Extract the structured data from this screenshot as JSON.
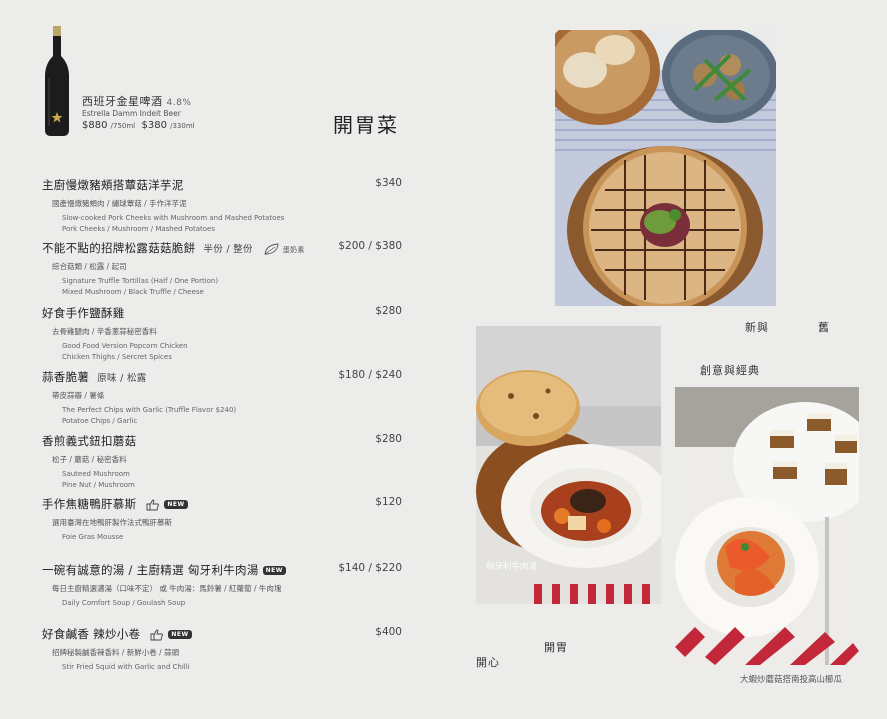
{
  "beer": {
    "name_zh": "西班牙金星啤酒",
    "abv": "4.8%",
    "name_en": "Estrella Damm Indeit Beer",
    "price_large": "$880",
    "vol_large": "/750ml",
    "price_small": "$380",
    "vol_small": "/330ml"
  },
  "section_title": "開胃菜",
  "items": [
    {
      "name": "主廚慢燉豬頰搭蕈菇洋芋泥",
      "price": "$340",
      "desc_zh": "國產慢燉豬頰肉 / 繡球蕈菇 / 手作洋芋泥",
      "desc_en": [
        "Slow-cooked Pork Cheeks with Mushroom and Mashed Potatoes",
        "Pork Cheeks / Mushroom / Mashed Potatoes"
      ]
    },
    {
      "name": "不能不點的招牌松露菇菇脆餅",
      "option": "半份 / 整份",
      "veg_label": "蛋奶素",
      "price": "$200 / $380",
      "desc_zh": "綜合菇類 / 松露 / 起司",
      "desc_en": [
        "Signature Truffle Tortillas (Half / One Portion)",
        "Mixed Mushroom / Black Truffle / Cheese"
      ]
    },
    {
      "name": "好食手作鹽酥雞",
      "price": "$280",
      "desc_zh": "去骨雞腿肉 / 辛香蔥蒜秘密香料",
      "desc_en": [
        "Good Food Version Popcorn Chicken",
        "Chicken Thighs / Sercret Spices"
      ]
    },
    {
      "name": "蒜香脆薯",
      "option": "原味 / 松露",
      "price": "$180 / $240",
      "desc_zh": "帶皮蒜瓣 / 薯條",
      "desc_en": [
        "The Perfect Chips with Garlic (Truffle Flavor $240)",
        "Potatoe Chips / Garlic"
      ]
    },
    {
      "name": "香煎義式鈕扣蘑菇",
      "price": "$280",
      "desc_zh": "松子 / 蘑菇 / 秘密香料",
      "desc_en": [
        "Sauteed Mushroom",
        "Pine Nut / Mushroom"
      ]
    },
    {
      "name": "手作焦糖鴨肝慕斯",
      "badge": "NEW",
      "price": "$120",
      "desc_zh": "選用臺灣在地鴨肝製作法式鴨肝慕斯",
      "desc_en": [
        "Foie Gras Mousse"
      ]
    },
    {
      "name": "一碗有誠意的湯 / 主廚精選 匈牙利牛肉湯",
      "badge": "NEW",
      "price": "$140 / $220",
      "desc_zh": "每日主廚精選濃湯（口味不定） 或 牛肉湯：馬鈴薯 / 紅蘿蔔 / 牛肉塊",
      "desc_en": [
        "Daily Comfort Soup / Goulash Soup"
      ]
    },
    {
      "name": "好食鹹香 辣炒小卷",
      "badge": "NEW",
      "price": "$400",
      "desc_zh": "招牌秘製鹹香辣香料 / 新鮮小卷 / 蒜頭",
      "desc_en": [
        "Stir Fried Squid with Garlic and Chilli"
      ]
    }
  ],
  "photos": {
    "soup_caption": "匈牙利牛肉湯",
    "shrimp_caption": "大蝦炒蘑菇搭南投高山櫛瓜"
  },
  "deco": {
    "new": "新與",
    "old": "舊",
    "creative": "創意與經典",
    "appetite": "開胃",
    "happy": "開心"
  },
  "colors": {
    "background": "#ececeb",
    "text": "#222222"
  }
}
